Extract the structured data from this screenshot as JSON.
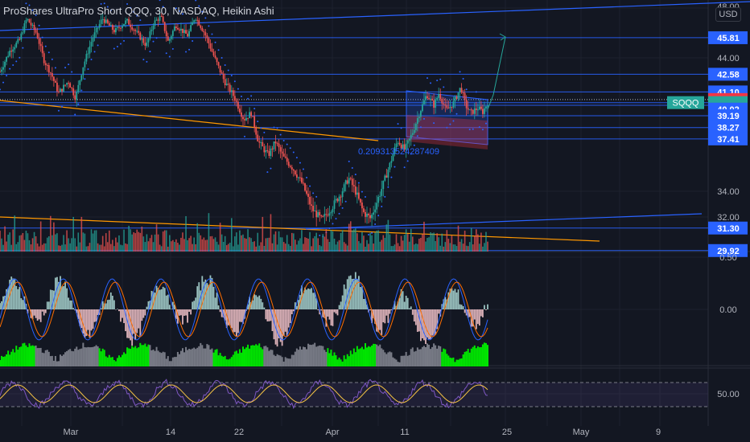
{
  "header": {
    "title": "ProShares UltraPro Short QQQ, 30, NASDAQ, Heikin Ashi",
    "currency": "USD"
  },
  "colors": {
    "background": "#131722",
    "grid": "#1e222d",
    "up": "#26a69a",
    "down": "#ef5350",
    "blue_line": "#2962ff",
    "orange_line": "#ff9800",
    "price_badge": "#26a69a",
    "red_badge": "#f23645",
    "macd_blue": "#2962ff",
    "macd_orange": "#ff6d00",
    "hist_up": "#b2dfdb",
    "hist_down": "#ffcdd2",
    "vol_green": "#00e600",
    "vol_grey": "#787b86",
    "rsi_purple": "#7e57c2",
    "rsi_yellow": "#f6c445"
  },
  "chart_data": [
    {
      "type": "line",
      "subtype": "candlestick-heikin-ashi",
      "symbol": "SQQQ",
      "y_scale": "log",
      "ylim": [
        29.5,
        48.5
      ],
      "price_axis_ticks": [
        "48.00",
        "44.00",
        "34.00",
        "32.00"
      ],
      "date_ticks": [
        "Mar",
        "14",
        "22",
        "Apr",
        "11",
        "25",
        "May",
        "9"
      ],
      "close_path": [
        {
          "t": 0,
          "p": 42.8
        },
        {
          "t": 0.02,
          "p": 44.6
        },
        {
          "t": 0.04,
          "p": 45.6
        },
        {
          "t": 0.055,
          "p": 47.6
        },
        {
          "t": 0.075,
          "p": 46.2
        },
        {
          "t": 0.09,
          "p": 43.8
        },
        {
          "t": 0.105,
          "p": 42.6
        },
        {
          "t": 0.12,
          "p": 41.0
        },
        {
          "t": 0.14,
          "p": 42.0
        },
        {
          "t": 0.155,
          "p": 40.6
        },
        {
          "t": 0.17,
          "p": 43.2
        },
        {
          "t": 0.19,
          "p": 45.8
        },
        {
          "t": 0.21,
          "p": 47.6
        },
        {
          "t": 0.235,
          "p": 46.4
        },
        {
          "t": 0.26,
          "p": 47.4
        },
        {
          "t": 0.28,
          "p": 46.3
        },
        {
          "t": 0.3,
          "p": 45.1
        },
        {
          "t": 0.315,
          "p": 47.2
        },
        {
          "t": 0.33,
          "p": 47.8
        },
        {
          "t": 0.345,
          "p": 45.4
        },
        {
          "t": 0.36,
          "p": 47.0
        },
        {
          "t": 0.385,
          "p": 46.0
        },
        {
          "t": 0.4,
          "p": 47.8
        },
        {
          "t": 0.42,
          "p": 46.2
        },
        {
          "t": 0.44,
          "p": 44.0
        },
        {
          "t": 0.46,
          "p": 42.0
        },
        {
          "t": 0.48,
          "p": 40.7
        },
        {
          "t": 0.5,
          "p": 38.9
        },
        {
          "t": 0.515,
          "p": 39.4
        },
        {
          "t": 0.53,
          "p": 37.2
        },
        {
          "t": 0.55,
          "p": 36.2
        },
        {
          "t": 0.565,
          "p": 37.2
        },
        {
          "t": 0.58,
          "p": 36.1
        },
        {
          "t": 0.6,
          "p": 35.3
        },
        {
          "t": 0.62,
          "p": 34.2
        },
        {
          "t": 0.64,
          "p": 32.5
        },
        {
          "t": 0.66,
          "p": 31.8
        },
        {
          "t": 0.68,
          "p": 32.6
        },
        {
          "t": 0.7,
          "p": 33.6
        },
        {
          "t": 0.715,
          "p": 34.6
        },
        {
          "t": 0.73,
          "p": 33.6
        },
        {
          "t": 0.745,
          "p": 32.3
        },
        {
          "t": 0.76,
          "p": 31.9
        },
        {
          "t": 0.78,
          "p": 33.6
        },
        {
          "t": 0.8,
          "p": 35.6
        },
        {
          "t": 0.815,
          "p": 37.3
        },
        {
          "t": 0.83,
          "p": 36.6
        },
        {
          "t": 0.845,
          "p": 37.8
        },
        {
          "t": 0.86,
          "p": 39.4
        },
        {
          "t": 0.875,
          "p": 40.9
        },
        {
          "t": 0.89,
          "p": 40.0
        },
        {
          "t": 0.9,
          "p": 41.0
        },
        {
          "t": 0.915,
          "p": 39.6
        },
        {
          "t": 0.93,
          "p": 40.2
        },
        {
          "t": 0.945,
          "p": 41.5
        },
        {
          "t": 0.955,
          "p": 40.0
        },
        {
          "t": 0.965,
          "p": 39.4
        },
        {
          "t": 0.98,
          "p": 39.8
        },
        {
          "t": 0.99,
          "p": 39.5
        },
        {
          "t": 1.0,
          "p": 40.23
        }
      ],
      "horizontal_levels": [
        45.81,
        42.58,
        41.1,
        40.48,
        40.23,
        40.02,
        39.19,
        38.27,
        37.41,
        31.3,
        29.92
      ],
      "price_labels": [
        {
          "v": 45.81,
          "text": "45.81",
          "color": "#2962ff"
        },
        {
          "v": 42.58,
          "text": "42.58",
          "color": "#2962ff"
        },
        {
          "v": 41.1,
          "text": "41.10",
          "color": "#2962ff"
        },
        {
          "v": 40.48,
          "text": "40.48",
          "color": "#f23645"
        },
        {
          "v": 40.23,
          "text": "40.23",
          "color": "#26a69a"
        },
        {
          "v": 39.98,
          "text": "04:50",
          "color": "#26a69a"
        },
        {
          "v": 39.71,
          "text": "40.02",
          "color": "#2962ff"
        },
        {
          "v": 39.19,
          "text": "39.19",
          "color": "#2962ff"
        },
        {
          "v": 38.27,
          "text": "38.27",
          "color": "#2962ff"
        },
        {
          "v": 37.41,
          "text": "37.41",
          "color": "#2962ff"
        },
        {
          "v": 31.3,
          "text": "31.30",
          "color": "#2962ff"
        },
        {
          "v": 29.92,
          "text": "29.92",
          "color": "#2962ff"
        }
      ],
      "annotation": "0.20931352428740​9"
    },
    {
      "type": "bar",
      "name": "volume",
      "ylim": [
        0,
        1
      ]
    },
    {
      "type": "line",
      "name": "macd",
      "ylim": [
        -0.5,
        0.5
      ],
      "ticks": [
        "0.50",
        "0.00"
      ]
    },
    {
      "type": "bar",
      "name": "volume-histogram",
      "ylim": [
        0,
        1
      ]
    },
    {
      "type": "line",
      "name": "rsi",
      "ylim": [
        20,
        80
      ],
      "ticks": [
        "50.00"
      ],
      "band": [
        30,
        70
      ]
    }
  ],
  "symbol_badge": "SQQQ"
}
